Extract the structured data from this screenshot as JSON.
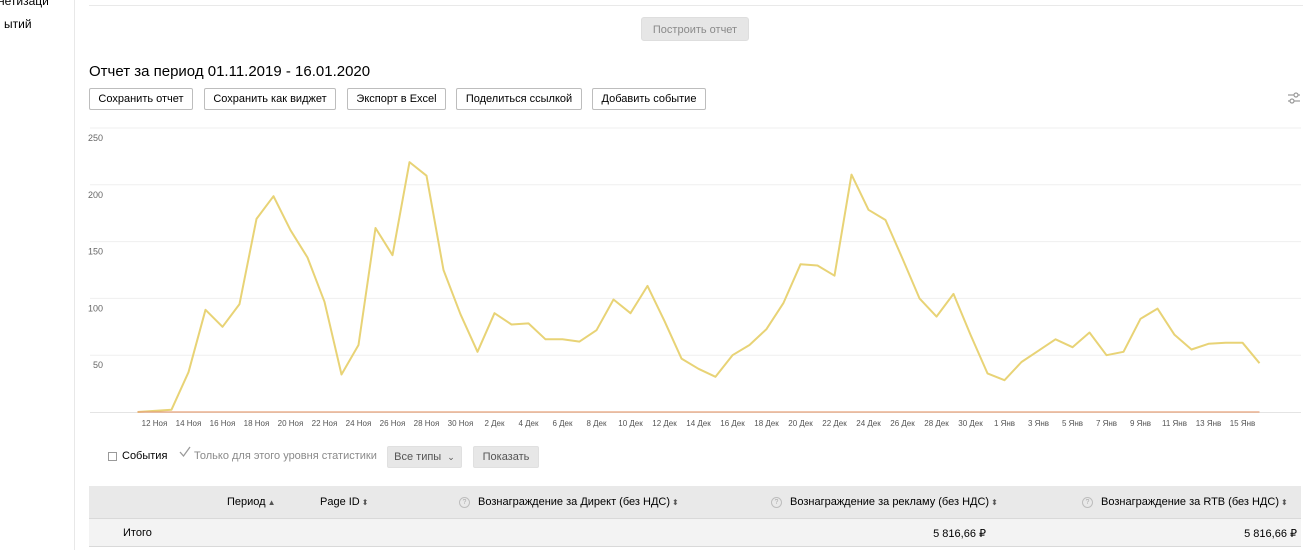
{
  "sidebar": {
    "items": [
      {
        "label": "нетизаци"
      },
      {
        "label": "ытий"
      }
    ]
  },
  "build_report_label": "Построить отчет",
  "report": {
    "title": "Отчет за период 01.11.2019 - 16.01.2020"
  },
  "toolbar": {
    "buttons": [
      {
        "label": "Сохранить отчет"
      },
      {
        "label": "Сохранить как виджет"
      },
      {
        "label": "Экспорт в Excel"
      },
      {
        "label": "Поделиться ссылкой"
      },
      {
        "label": "Добавить событие"
      }
    ],
    "settings_icon": "sliders-icon"
  },
  "chart_data": {
    "type": "line",
    "ylim": [
      0,
      250
    ],
    "yticks": [
      50,
      100,
      150,
      200,
      250
    ],
    "grid": true,
    "colors": {
      "line": "#e8d376",
      "baseline": "#e6a27a",
      "grid": "#efefef"
    },
    "x": [
      "11 Ноя",
      "12 Ноя",
      "13 Ноя",
      "14 Ноя",
      "15 Ноя",
      "16 Ноя",
      "17 Ноя",
      "18 Ноя",
      "19 Ноя",
      "20 Ноя",
      "21 Ноя",
      "22 Ноя",
      "23 Ноя",
      "24 Ноя",
      "25 Ноя",
      "26 Ноя",
      "27 Ноя",
      "28 Ноя",
      "29 Ноя",
      "30 Ноя",
      "1 Дек",
      "2 Дек",
      "3 Дек",
      "4 Дек",
      "5 Дек",
      "6 Дек",
      "7 Дек",
      "8 Дек",
      "9 Дек",
      "10 Дек",
      "11 Дек",
      "12 Дек",
      "13 Дек",
      "14 Дек",
      "15 Дек",
      "16 Дек",
      "17 Дек",
      "18 Дек",
      "19 Дек",
      "20 Дек",
      "21 Дек",
      "22 Дек",
      "23 Дек",
      "24 Дек",
      "25 Дек",
      "26 Дек",
      "27 Дек",
      "28 Дек",
      "29 Дек",
      "30 Дек",
      "31 Дек",
      "1 Янв",
      "2 Янв",
      "3 Янв",
      "4 Янв",
      "5 Янв",
      "6 Янв",
      "7 Янв",
      "8 Янв",
      "9 Янв",
      "10 Янв",
      "11 Янв",
      "12 Янв",
      "13 Янв",
      "14 Янв",
      "15 Янв",
      "16 Янв"
    ],
    "tick_labels": [
      "12 Ноя",
      "14 Ноя",
      "16 Ноя",
      "18 Ноя",
      "20 Ноя",
      "22 Ноя",
      "24 Ноя",
      "26 Ноя",
      "28 Ноя",
      "30 Ноя",
      "2 Дек",
      "4 Дек",
      "6 Дек",
      "8 Дек",
      "10 Дек",
      "12 Дек",
      "14 Дек",
      "16 Дек",
      "18 Дек",
      "20 Дек",
      "22 Дек",
      "24 Дек",
      "26 Дек",
      "28 Дек",
      "30 Дек",
      "1 Янв",
      "3 Янв",
      "5 Янв",
      "7 Янв",
      "9 Янв",
      "11 Янв",
      "13 Янв",
      "15 Янв"
    ],
    "series": [
      {
        "values": [
          0,
          1,
          2,
          35,
          90,
          75,
          95,
          170,
          190,
          160,
          136,
          97,
          33,
          59,
          162,
          138,
          220,
          208,
          125,
          86,
          53,
          87,
          77,
          78,
          64,
          64,
          62,
          72,
          99,
          87,
          111,
          80,
          47,
          38,
          31,
          50,
          59,
          73,
          96,
          130,
          129,
          120,
          209,
          178,
          169,
          135,
          100,
          84,
          104,
          68,
          34,
          28,
          44,
          54,
          64,
          57,
          70,
          50,
          53,
          82,
          91,
          68,
          55,
          60,
          61,
          61,
          43
        ]
      },
      {
        "values": [
          0,
          0,
          0,
          0,
          0,
          0,
          0,
          0,
          0,
          0,
          0,
          0,
          0,
          0,
          0,
          0,
          0,
          0,
          0,
          0,
          0,
          0,
          0,
          0,
          0,
          0,
          0,
          0,
          0,
          0,
          0,
          0,
          0,
          0,
          0,
          0,
          0,
          0,
          0,
          0,
          0,
          0,
          0,
          0,
          0,
          0,
          0,
          0,
          0,
          0,
          0,
          0,
          0,
          0,
          0,
          0,
          0,
          0,
          0,
          0,
          0,
          0,
          0,
          0,
          0,
          0,
          0
        ]
      }
    ]
  },
  "events": {
    "events_label": "События",
    "only_level_label": "Только для этого уровня статистики",
    "all_types_label": "Все типы",
    "show_label": "Показать"
  },
  "table": {
    "headers": [
      {
        "label": "Период",
        "sort": "▲"
      },
      {
        "label": "Page ID",
        "sort": "⬍"
      },
      {
        "label": "Вознаграждение за Директ (без НДС)",
        "sort": "⬍",
        "help": "?"
      },
      {
        "label": "Вознаграждение за рекламу (без НДС)",
        "sort": "⬍",
        "help": "?"
      },
      {
        "label": "Вознаграждение за RTB (без НДС)",
        "sort": "⬍",
        "help": "?"
      }
    ],
    "total_label": "Итого",
    "total_ad": "5 816,66 ₽",
    "total_rtb": "5 816,66 ₽"
  }
}
